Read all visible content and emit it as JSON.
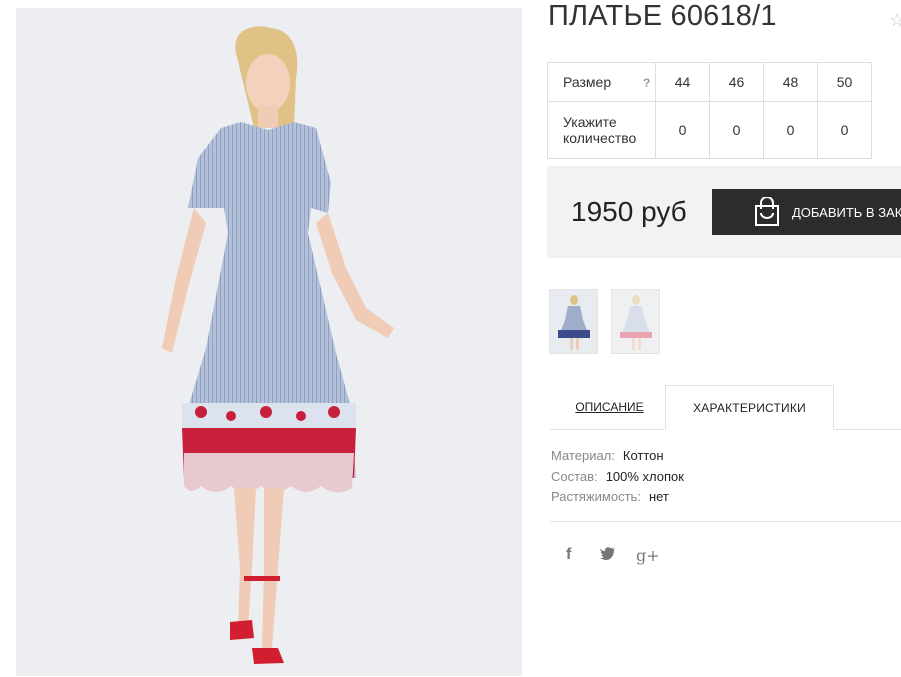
{
  "product": {
    "title": "ПЛАТЬЕ 60618/1",
    "favorite_icon": "star-icon"
  },
  "sizes": {
    "size_label": "Размер",
    "help_mark": "?",
    "quantity_label": "Укажите количество",
    "columns": [
      {
        "size": "44",
        "qty": "0"
      },
      {
        "size": "46",
        "qty": "0"
      },
      {
        "size": "48",
        "qty": "0"
      },
      {
        "size": "50",
        "qty": "0"
      }
    ]
  },
  "purchase": {
    "price": "1950 руб",
    "add_button_label": "ДОБАВИТЬ В ЗАКАЗ",
    "button_icon": "shopping-bag-icon"
  },
  "gallery": {
    "thumbnails": [
      "thumbnail-front-view",
      "thumbnail-faded-view"
    ]
  },
  "tabs": {
    "description": "ОПИСАНИЕ",
    "specs": "ХАРАКТЕРИСТИКИ",
    "active": "specs"
  },
  "specs": [
    {
      "key": "Материал:",
      "value": "Коттон"
    },
    {
      "key": "Состав:",
      "value": "100% хлопок"
    },
    {
      "key": "Растяжимость:",
      "value": "нет"
    }
  ],
  "social": {
    "facebook": "f",
    "twitter": "🐦",
    "gplus": "g+"
  },
  "colors": {
    "button_bg": "#2c2c2c",
    "buy_block_bg": "#f2f2f2",
    "dress_blue": "#aab8d4",
    "embroidery_red": "#c8203a"
  }
}
